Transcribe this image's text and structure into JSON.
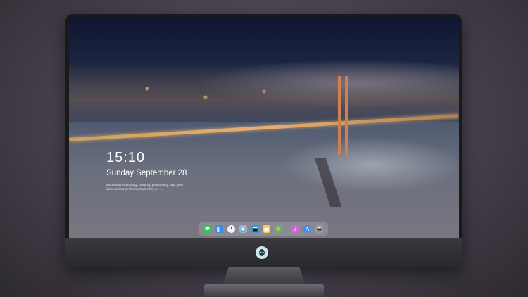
{
  "lockscreen": {
    "time": "15:10",
    "date": "Sunday September 28",
    "tagline": "Innovating technology, Ensuring productivity, Max. your ideal companion for a smarter life, d... ..."
  },
  "dock": {
    "items": [
      {
        "name": "messages-icon",
        "color": "#34c759"
      },
      {
        "name": "finder-icon",
        "color": "#3a8ee6"
      },
      {
        "name": "clock-icon",
        "color": "#f2f2f2"
      },
      {
        "name": "preview-icon",
        "color": "#8fb8e0"
      },
      {
        "name": "clapper-icon",
        "color": "#2d9cdb"
      },
      {
        "name": "notes-icon",
        "color": "#f5d14a"
      },
      {
        "name": "photos-icon",
        "color": "#62b36b"
      },
      {
        "name": "music-icon",
        "color": "#d266d6"
      },
      {
        "name": "appstore-icon",
        "color": "#3b8cf3"
      },
      {
        "name": "printer-icon",
        "color": "#9a9aa2"
      }
    ]
  },
  "brand": {
    "logo": "alien-logo-icon"
  }
}
